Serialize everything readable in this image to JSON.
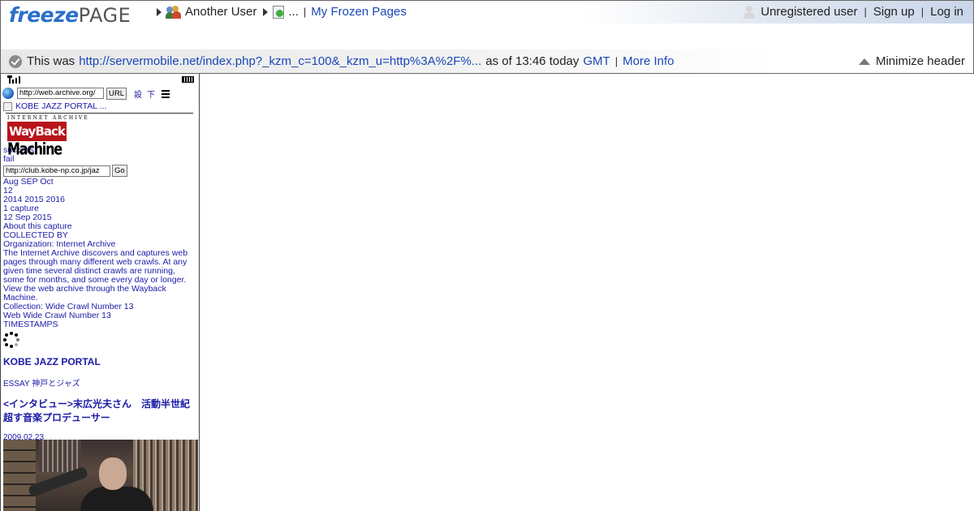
{
  "header": {
    "logo": {
      "part1": "freeze",
      "part2": "PAGE"
    },
    "breadcrumb": {
      "user": "Another User",
      "ellipsis": "...",
      "frozen_pages": "My Frozen Pages"
    },
    "account": {
      "status": "Unregistered user",
      "sign_up": "Sign up",
      "log_in": "Log in"
    },
    "info": {
      "prefix": "This was",
      "url": "http://servermobile.net/index.php?_kzm_c=100&_kzm_u=http%3A%2F%...",
      "as_of": "as of 13:46 today",
      "tz": "GMT",
      "more_info": "More Info",
      "minimize": "Minimize header"
    }
  },
  "mobile": {
    "url_value": "http://web.archive.org/",
    "url_button": "URL",
    "settings_link": "設",
    "down_link": "下",
    "portal_link": "KOBE JAZZ PORTAL ...",
    "wayback": {
      "internet_archive": "INTERNET ARCHIVE",
      "way": "WayBack",
      "machine": "Machine"
    },
    "success": "success",
    "fail": "fail",
    "go_url_value": "http://club.kobe-np.co.jp/jaz",
    "go_button": "Go",
    "months": "Aug SEP Oct",
    "day": "12",
    "years": "2014 2015 2016",
    "captures": "1 capture",
    "capture_date": "12 Sep 2015",
    "about": "About this capture",
    "collected_by": "COLLECTED BY",
    "organization": "Organization: Internet Archive",
    "description": "The Internet Archive discovers and captures web pages through many different web crawls. At any given time several distinct crawls are running, some for months, and some every day or longer. View the web archive through the Wayback Machine.",
    "collection": "Collection: Wide Crawl Number 13",
    "crawl": "Web Wide Crawl Number 13",
    "timestamps": "TIMESTAMPS",
    "site_title": "KOBE JAZZ PORTAL",
    "essay": "ESSAY 神戸とジャズ",
    "headline": "<インタビュー>末広光夫さん　活動半世紀超す音楽プロデューサー",
    "date": "2009.02.23"
  },
  "colors": {
    "link": "#1a47b8",
    "mobile_link": "#1a1aa8",
    "logo_blue": "#2a6fc9",
    "wayback_red": "#b8141a"
  }
}
